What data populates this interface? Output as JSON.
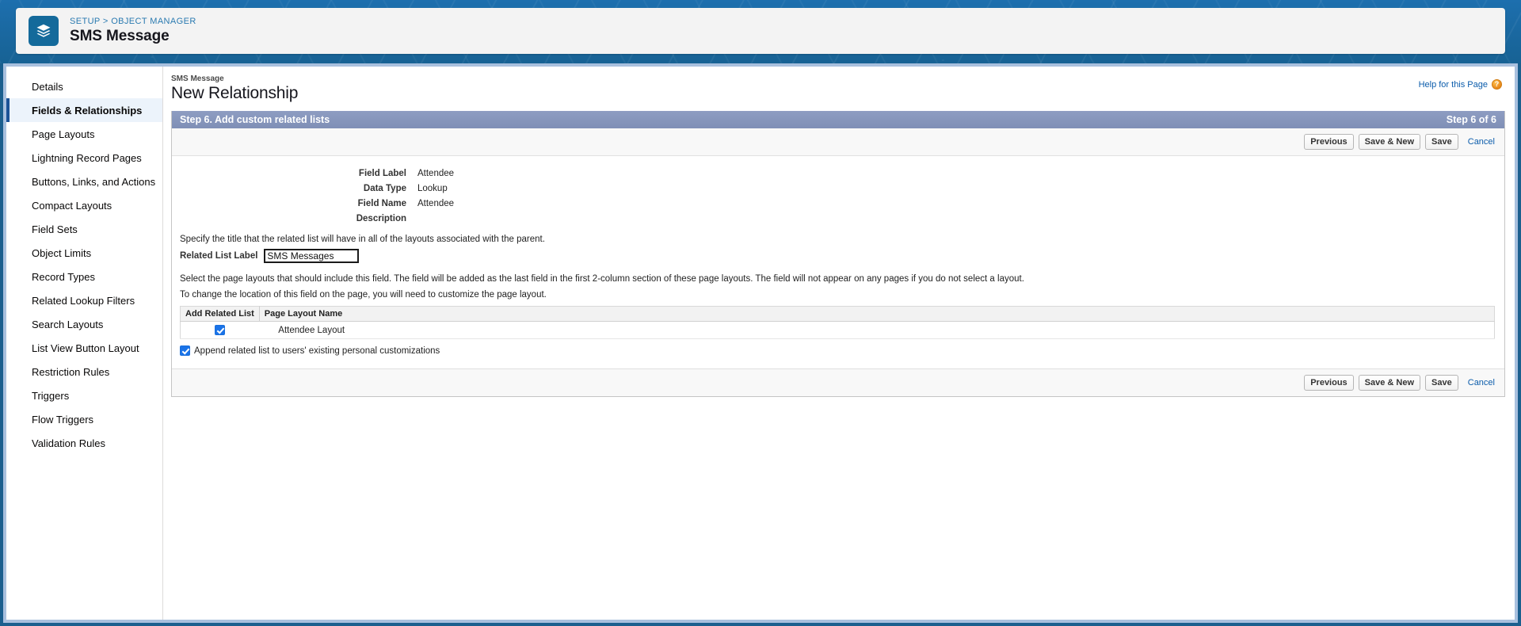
{
  "header": {
    "breadcrumb": "SETUP > OBJECT MANAGER",
    "object_title": "SMS Message",
    "icon": "layers-stack-icon",
    "icon_bg": "#146a9b"
  },
  "sidebar": {
    "items": [
      {
        "label": "Details",
        "active": false
      },
      {
        "label": "Fields & Relationships",
        "active": true
      },
      {
        "label": "Page Layouts",
        "active": false
      },
      {
        "label": "Lightning Record Pages",
        "active": false
      },
      {
        "label": "Buttons, Links, and Actions",
        "active": false
      },
      {
        "label": "Compact Layouts",
        "active": false
      },
      {
        "label": "Field Sets",
        "active": false
      },
      {
        "label": "Object Limits",
        "active": false
      },
      {
        "label": "Record Types",
        "active": false
      },
      {
        "label": "Related Lookup Filters",
        "active": false
      },
      {
        "label": "Search Layouts",
        "active": false
      },
      {
        "label": "List View Button Layout",
        "active": false
      },
      {
        "label": "Restriction Rules",
        "active": false
      },
      {
        "label": "Triggers",
        "active": false
      },
      {
        "label": "Flow Triggers",
        "active": false
      },
      {
        "label": "Validation Rules",
        "active": false
      }
    ]
  },
  "main": {
    "eyebrow": "SMS Message",
    "page_title": "New Relationship",
    "help_label": "Help for this Page",
    "help_icon": "question-mark-icon",
    "step": {
      "title": "Step 6. Add custom related lists",
      "counter": "Step 6 of 6"
    },
    "buttons": {
      "previous": "Previous",
      "save_and_new": "Save & New",
      "save": "Save",
      "cancel": "Cancel"
    },
    "summary_fields": [
      {
        "label": "Field Label",
        "value": "Attendee"
      },
      {
        "label": "Data Type",
        "value": "Lookup"
      },
      {
        "label": "Field Name",
        "value": "Attendee"
      },
      {
        "label": "Description",
        "value": ""
      }
    ],
    "related_list_help": "Specify the title that the related list will have in all of the layouts associated with the parent.",
    "related_list_label_text": "Related List Label",
    "related_list_label_value": "SMS Messages",
    "layout_help_1": "Select the page layouts that should include this field. The field will be added as the last field in the first 2-column section of these page layouts. The field will not appear on any pages if you do not select a layout.",
    "layout_help_2": "To change the location of this field on the page, you will need to customize the page layout.",
    "layout_table": {
      "columns": [
        "Add Related List",
        "Page Layout Name"
      ],
      "rows": [
        {
          "checked": true,
          "name": "Attendee Layout"
        }
      ]
    },
    "append_checkbox": {
      "checked": true,
      "label": "Append related list to users' existing personal customizations"
    }
  },
  "colors": {
    "banner_blue": "#1a6ba8",
    "step_header": "#8897bd",
    "link_blue": "#0b5cab",
    "active_nav_bg": "#ecf3fb",
    "active_nav_bar": "#1b5297",
    "frame_blue": "#a9c0de"
  }
}
